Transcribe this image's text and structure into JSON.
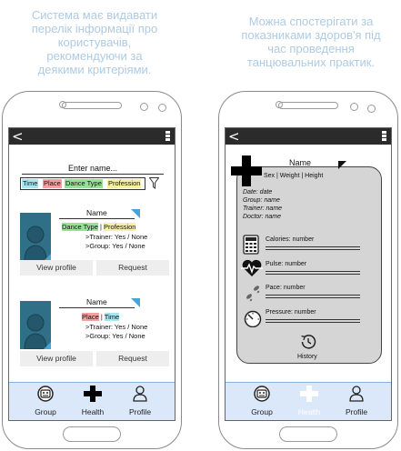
{
  "captions": {
    "left": [
      "Система має видавати",
      "перелік інформації про",
      "користувачів,",
      "рекомендуючи за",
      "деякими критеріями."
    ],
    "right": [
      "Можна спостерігати за",
      "показниками здоров'я під",
      "час проведення",
      "танцювальних практик."
    ]
  },
  "status_bar": {
    "back_glyph": "<"
  },
  "search": {
    "label": "Enter name..."
  },
  "filters": [
    {
      "label": "Time",
      "color": "#a6e6f2"
    },
    {
      "label": "Place",
      "color": "#f2a0a0"
    },
    {
      "label": "Dance Type",
      "color": "#98e09a"
    },
    {
      "label": "Profession",
      "color": "#f6f0a6"
    }
  ],
  "cards": [
    {
      "name": "Name",
      "tags": [
        {
          "label": "Dance Type",
          "color": "#98e09a"
        },
        {
          "label": "Profession",
          "color": "#f6f0a6"
        }
      ],
      "separator": "|",
      "trainer": ">Trainer: Yes / None",
      "group": ">Group: Yes / None",
      "view_label": "View profile",
      "request_label": "Request"
    },
    {
      "name": "Name",
      "tags": [
        {
          "label": "Place",
          "color": "#f2a0a0"
        },
        {
          "label": "Time",
          "color": "#a6e6f2"
        }
      ],
      "separator": "|",
      "trainer": ">Trainer: Yes / None",
      "group": ">Group: Yes / None",
      "view_label": "View profile",
      "request_label": "Request"
    }
  ],
  "tabs": [
    {
      "label": "Group",
      "icon": "group-icon"
    },
    {
      "label": "Health",
      "icon": "health-cross-icon"
    },
    {
      "label": "Profile",
      "icon": "profile-icon"
    }
  ],
  "health": {
    "name": "Name",
    "stats": "Sex  |  Weight  |  Height",
    "details": [
      "Date: date",
      "Group: name",
      "Trainer: name",
      "Doctor: name"
    ],
    "metrics": [
      {
        "label": "Calories: number",
        "icon": "calculator-icon"
      },
      {
        "label": "Pulse: number",
        "icon": "heart-pulse-icon"
      },
      {
        "label": "Pace: number",
        "icon": "footsteps-icon"
      },
      {
        "label": "Pressure: number",
        "icon": "gauge-icon"
      }
    ],
    "history_label": "History"
  },
  "colors": {
    "accent_blue": "#4aa3d8",
    "tabbar": "#dbe8f9",
    "status_bar": "#2b2b2b",
    "panel": "#d5d5d5"
  }
}
